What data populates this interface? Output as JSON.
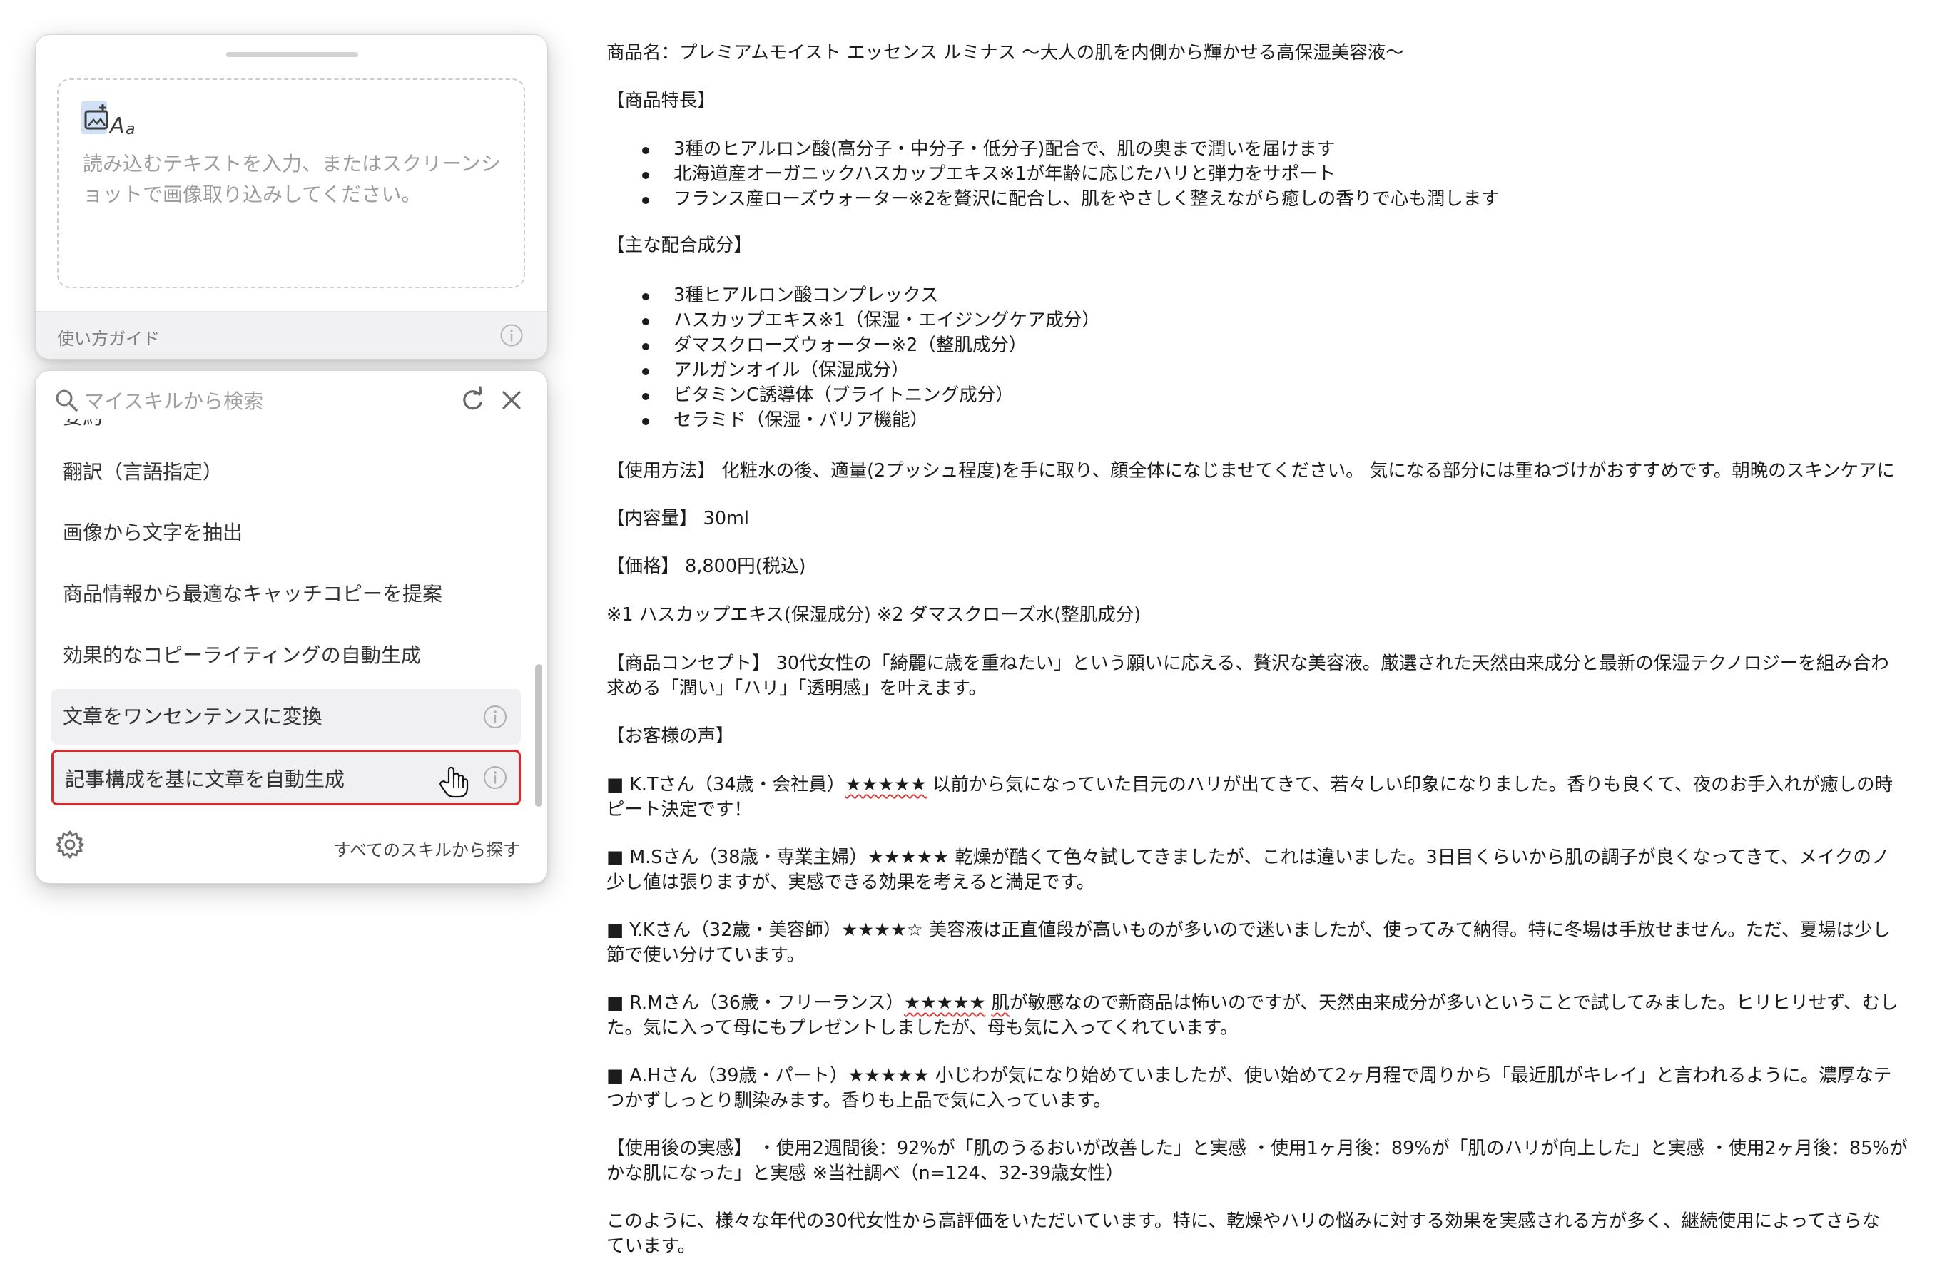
{
  "input_panel": {
    "placeholder": "読み込むテキストを入力、またはスクリーンショットで画像取り込みしてください。",
    "guide_link": "使い方ガイド"
  },
  "skills_panel": {
    "search_placeholder": "マイスキルから検索",
    "partial_item": "要約",
    "items": [
      {
        "label": "翻訳（言語指定）"
      },
      {
        "label": "画像から文字を抽出"
      },
      {
        "label": "商品情報から最適なキャッチコピーを提案"
      },
      {
        "label": "効果的なコピーライティングの自動生成"
      },
      {
        "label": "文章をワンセンテンスに変換"
      },
      {
        "label": "記事構成を基に文章を自動生成"
      }
    ],
    "all_skills_link": "すべてのスキルから探す",
    "highlight_color": "#d92a2a"
  },
  "document": {
    "title": "商品名：プレミアムモイスト エッセンス ルミナス 〜大人の肌を内側から輝かせる高保湿美容液〜",
    "features_heading": "【商品特長】",
    "features": [
      "3種のヒアルロン酸(高分子・中分子・低分子)配合で、肌の奥まで潤いを届けます",
      "北海道産オーガニックハスカップエキス※1が年齢に応じたハリと弾力をサポート",
      "フランス産ローズウォーター※2を贅沢に配合し、肌をやさしく整えながら癒しの香りで心も潤します"
    ],
    "ingredients_heading": "【主な配合成分】",
    "ingredients": [
      "3種ヒアルロン酸コンプレックス",
      "ハスカップエキス※1（保湿・エイジングケア成分）",
      "ダマスクローズウォーター※2（整肌成分）",
      "アルガンオイル（保湿成分）",
      "ビタミンC誘導体（ブライトニング成分）",
      "セラミド（保湿・バリア機能）"
    ],
    "usage": "【使用方法】 化粧水の後、適量(2プッシュ程度)を手に取り、顔全体になじませてください。 気になる部分には重ねづけがおすすめです。朝晩のスキンケアに",
    "volume": "【内容量】 30ml",
    "price": "【価格】 8,800円(税込)",
    "notes": "※1 ハスカップエキス(保湿成分) ※2 ダマスクローズ水(整肌成分)",
    "concept_line1": "【商品コンセプト】 30代女性の「綺麗に歳を重ねたい」という願いに応える、贅沢な美容液。厳選された天然由来成分と最新の保湿テクノロジーを組み合わ",
    "concept_line2": "求める「潤い」「ハリ」「透明感」を叶えます。",
    "voices_heading": "【お客様の声】",
    "review1_pre": "■ K.Tさん（34歳・会社員）",
    "review1_stars": "★★★★★",
    "review1_post": " 以前から気になっていた目元のハリが出てきて、若々しい印象になりました。香りも良くて、夜のお手入れが癒しの時",
    "review1_line2": "ピート決定です！",
    "review2_line1": "■ M.Sさん（38歳・専業主婦）★★★★★ 乾燥が酷くて色々試してきましたが、これは違いました。3日目くらいから肌の調子が良くなってきて、メイクのノ",
    "review2_line2": "少し値は張りますが、実感できる効果を考えると満足です。",
    "review3_line1": "■ Y.Kさん（32歳・美容師）★★★★☆ 美容液は正直値段が高いものが多いので迷いましたが、使ってみて納得。特に冬場は手放せません。ただ、夏場は少し",
    "review3_line2": "節で使い分けています。",
    "review4_pre": "■ R.Mさん（36歳・フリーランス）",
    "review4_stars": "★★★★★",
    "review4_mid": " ",
    "review4_word": "肌",
    "review4_post": "が敏感なので新商品は怖いのですが、天然由来成分が多いということで試してみました。ヒリヒリせず、むし",
    "review4_line2": "た。気に入って母にもプレゼントしましたが、母も気に入ってくれています。",
    "review5_line1": "■ A.Hさん（39歳・パート）★★★★★ 小じわが気になり始めていましたが、使い始めて2ヶ月程で周りから「最近肌がキレイ」と言われるように。濃厚なテ",
    "review5_line2": "つかずしっとり馴染みます。香りも上品で気に入っています。",
    "results_line1": "【使用後の実感】 ・使用2週間後：92%が「肌のうるおいが改善した」と実感 ・使用1ヶ月後：89%が「肌のハリが向上した」と実感 ・使用2ヶ月後：85%が",
    "results_line2": "かな肌になった」と実感 ※当社調べ（n=124、32-39歳女性）",
    "closing_line1": "このように、様々な年代の30代女性から高評価をいただいています。特に、乾燥やハリの悩みに対する効果を実感される方が多く、継続使用によってさらな",
    "closing_line2": "ています。"
  }
}
